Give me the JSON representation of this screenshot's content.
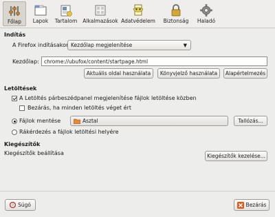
{
  "toolbar": {
    "items": [
      {
        "label": "Főlap",
        "icon": "sliders-icon",
        "active": true
      },
      {
        "label": "Lapok",
        "icon": "tabs-icon"
      },
      {
        "label": "Tartalom",
        "icon": "content-icon"
      },
      {
        "label": "Alkalmazások",
        "icon": "applications-icon"
      },
      {
        "label": "Adatvédelem",
        "icon": "privacy-mask-icon"
      },
      {
        "label": "Biztonság",
        "icon": "padlock-icon"
      },
      {
        "label": "Haladó",
        "icon": "gear-icon"
      }
    ]
  },
  "startup": {
    "title": "Indítás",
    "when_label": "A Firefox indításakor:",
    "when_value": "Kezdőlap megjelenítése",
    "homepage_label": "Kezdőlap:",
    "homepage_value": "chrome://ubufox/content/startpage.html",
    "use_current": "Aktuális oldal használata",
    "use_bookmark": "Könyvjelző használata",
    "restore_default": "Alapértelmezés"
  },
  "downloads": {
    "title": "Letöltések",
    "show_window": "A Letöltés párbeszédpanel megjelenítése fájlok letöltése közben",
    "show_window_checked": true,
    "close_when_done": "Bezárás, ha minden letöltés véget ért",
    "close_when_done_checked": false,
    "save_files_label": "Fájlok mentése",
    "save_files_selected": true,
    "save_folder": "Asztal",
    "browse": "Tallózás...",
    "always_ask": "Rákérdezés a fájlok letöltési helyére"
  },
  "addons": {
    "title": "Kiegészítők",
    "description": "Kiegészítők beállítása",
    "manage": "Kiegészítők kezelése..."
  },
  "footer": {
    "help": "Súgó",
    "close": "Bezárás"
  },
  "colors": {
    "window_bg": "#ededeb",
    "close_icon": "#e05a1a",
    "help_icon": "#c0392b"
  }
}
